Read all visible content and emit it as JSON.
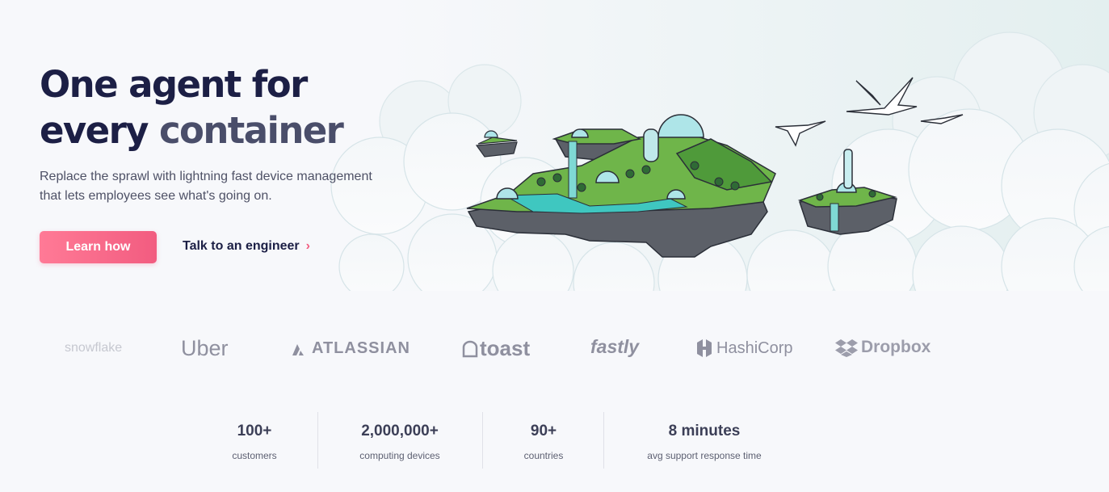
{
  "hero": {
    "headline_line1": "One agent for",
    "headline_line2_a": "every",
    "headline_line2_b": "container",
    "subcopy": "Replace the sprawl with lightning fast device management that lets employees see what's going on.",
    "primary_cta": "Learn how",
    "secondary_cta": "Talk to an engineer",
    "secondary_icon": "chevron-right-icon"
  },
  "logos": [
    {
      "name": "snowflake",
      "icon": "snowflake-logo"
    },
    {
      "name": "Uber",
      "icon": "uber-logo"
    },
    {
      "name": "ATLASSIAN",
      "icon": "atlassian-logo"
    },
    {
      "name": "toast",
      "icon": "toast-logo"
    },
    {
      "name": "fastly",
      "icon": "fastly-logo"
    },
    {
      "name": "HashiCorp",
      "icon": "hashicorp-logo"
    },
    {
      "name": "Dropbox",
      "icon": "dropbox-logo"
    }
  ],
  "stats": [
    {
      "value": "100+",
      "label": "customers"
    },
    {
      "value": "2,000,000+",
      "label": "computing devices"
    },
    {
      "value": "90+",
      "label": "countries"
    },
    {
      "value": "8 minutes",
      "label": "avg support response time"
    }
  ],
  "colors": {
    "primary_button": "#f25c80",
    "headline": "#1c1f45",
    "accent_text": "#4a4e6a",
    "body_text": "#4e5166"
  }
}
